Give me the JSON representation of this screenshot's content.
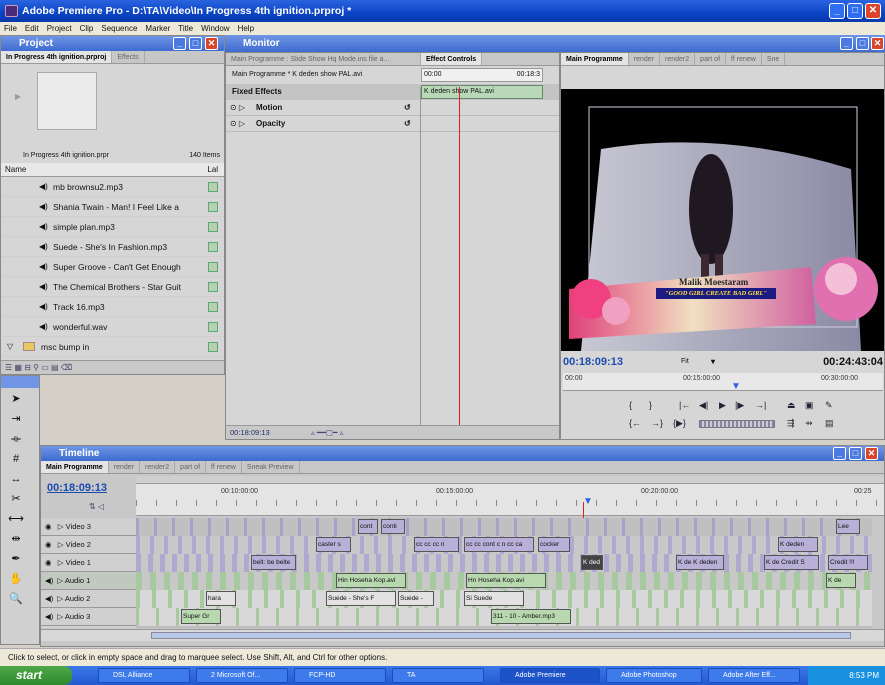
{
  "window": {
    "title": "Adobe Premiere Pro - D:\\TA\\Video\\In Progress 4th ignition.prproj *"
  },
  "menu": [
    "File",
    "Edit",
    "Project",
    "Clip",
    "Sequence",
    "Marker",
    "Title",
    "Window",
    "Help"
  ],
  "project": {
    "header": "Project",
    "tabs": [
      "In Progress 4th ignition.prproj",
      "Effects"
    ],
    "file_label": "In Progress 4th ignition.prpr",
    "item_count": "140 Items",
    "col_name": "Name",
    "col_label": "Lal",
    "items": [
      "mb brownsu2.mp3",
      "Shania Twain - Man! I Feel Like a",
      "simple plan.mp3",
      "Suede - She's In Fashion.mp3",
      "Super Groove - Can't Get Enough",
      "The Chemical Brothers - Star Guit",
      "Track 16.mp3",
      "wonderful.wav"
    ],
    "folder": "msc bump in"
  },
  "monitor": {
    "header": "Monitor",
    "source_tab": "Main Programme : Slide Show Hq Mode.ins file a...",
    "effect_tab": "Effect Controls",
    "clip_path": "Main Programme * K deden show PAL.avi",
    "clip_name": "K deden show PAL.avi",
    "time_start": "00:00",
    "time_end": "00:18:3",
    "fixed_effects": "Fixed Effects",
    "motion": "Motion",
    "opacity": "Opacity",
    "ec_time": "00:18:09:13",
    "program_tabs": [
      "Main Programme",
      "render",
      "render2",
      "part of",
      "ff renew",
      "Sne"
    ],
    "overlay_title": "Malik Moestaram",
    "overlay_sub": "\"GOOD GIRL CREATE BAD GIRL\"",
    "current_time": "00:18:09:13",
    "fit": "Fit",
    "duration": "00:24:43:04",
    "ruler_labels": [
      "00:00",
      "00:15:00:00",
      "00:30:00:00"
    ]
  },
  "timeline": {
    "header": "Timeline",
    "tabs": [
      "Main Programme",
      "render",
      "render2",
      "part of",
      "ff renew",
      "Sneak Preview"
    ],
    "time": "00:18:09:13",
    "ruler_labels": [
      "00:10:00:00",
      "00:15:00:00",
      "00:20:00:00",
      "00:25"
    ],
    "tracks": [
      "Video 3",
      "Video 2",
      "Video 1",
      "Audio 1",
      "Audio 2",
      "Audio 3"
    ],
    "clips": {
      "v3a": "cont",
      "v3b": "conti",
      "v3c": "Lee",
      "v2a": "caster s",
      "v2b": "cc cc cc n",
      "v2c": "cc cc cont c n cc ca",
      "v2d": "cocker",
      "v2e": "K deden",
      "v1a": "belt: be belte",
      "v1b": "K ded",
      "v1c": "K de K deden",
      "v1d": "K de Credit S",
      "v1e": "Credit !!!",
      "a1a": "Hin Hoseha Kop.avi",
      "a1b": "Hn Hoseha Kop.avi",
      "a1c": "K de",
      "a2a": "hara",
      "a2b": "Suede - She's F",
      "a2c": "Suede -",
      "a2d": "Si Suede",
      "a3a": "Super Gr",
      "a3b": "311 - 10 - Amber.mp3"
    }
  },
  "status": "Click to select, or click in empty space and drag to marquee select. Use Shift, Alt, and Ctrl for other options.",
  "taskbar": {
    "start": "start",
    "items": [
      "DSL Alliance",
      "2 Microsoft Of...",
      "FCP-HD",
      "TA",
      "Adobe Premiere",
      "Adobe Photoshop",
      "Adobe After Eff..."
    ],
    "clock": "8:53 PM"
  }
}
